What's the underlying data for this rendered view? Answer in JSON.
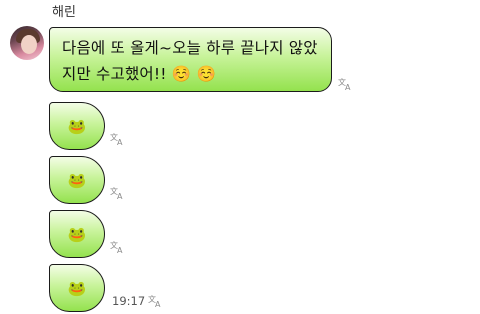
{
  "sender": {
    "name": "해린"
  },
  "messages": [
    {
      "type": "text",
      "text_line1": "다음에 또 올게~오늘 하루 끝나지 않았",
      "text_line2": "지만 수고했어!! ☺️ ☺️"
    },
    {
      "type": "emoji",
      "emoji": "🐸"
    },
    {
      "type": "emoji",
      "emoji": "🐸"
    },
    {
      "type": "emoji",
      "emoji": "🐸"
    },
    {
      "type": "emoji",
      "emoji": "🐸",
      "time": "19:17"
    }
  ],
  "icons": {
    "translate": "translate-icon"
  },
  "colors": {
    "bubble_top": "#f3fde6",
    "bubble_bottom": "#94e24e",
    "bubble_border": "#1b1b1b"
  }
}
